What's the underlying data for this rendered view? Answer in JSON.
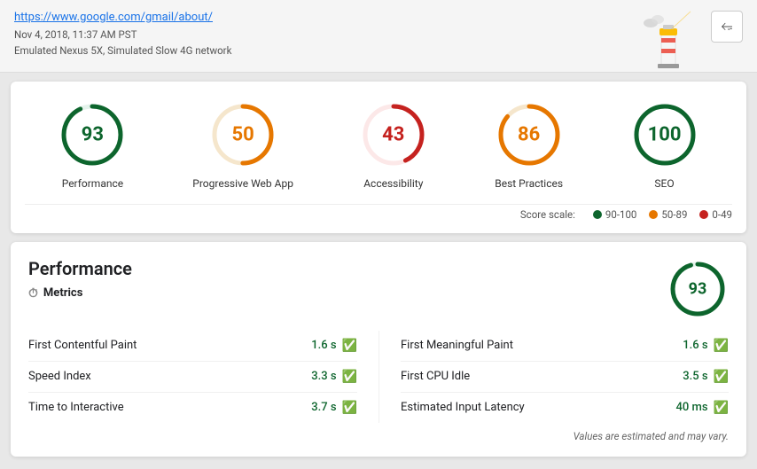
{
  "header": {
    "url": "https://www.google.com/gmail/about/",
    "timestamp": "Nov 4, 2018, 11:37 AM PST",
    "device": "Emulated Nexus 5X, Simulated Slow 4G network",
    "share_label": "⤴"
  },
  "scores": [
    {
      "id": "performance",
      "label": "Performance",
      "value": 93,
      "color": "#0d652d",
      "track": "#e5f3ec",
      "ring": "#0d652d"
    },
    {
      "id": "pwa",
      "label": "Progressive Web App",
      "value": 50,
      "color": "#e67700",
      "track": "#f5e6cc",
      "ring": "#e67700"
    },
    {
      "id": "accessibility",
      "label": "Accessibility",
      "value": 43,
      "color": "#c5221f",
      "track": "#fce8e8",
      "ring": "#c5221f"
    },
    {
      "id": "best-practices",
      "label": "Best Practices",
      "value": 86,
      "color": "#e67700",
      "track": "#f5e6cc",
      "ring": "#e67700"
    },
    {
      "id": "seo",
      "label": "SEO",
      "value": 100,
      "color": "#0d652d",
      "track": "#e5f3ec",
      "ring": "#0d652d"
    }
  ],
  "score_scale": {
    "label": "Score scale:",
    "items": [
      {
        "range": "90-100",
        "color": "#0d652d"
      },
      {
        "range": "50-89",
        "color": "#e67700"
      },
      {
        "range": "0-49",
        "color": "#c5221f"
      }
    ]
  },
  "performance_section": {
    "title": "Performance",
    "metrics_label": "Metrics",
    "score": 93,
    "metrics_left": [
      {
        "name": "First Contentful Paint",
        "value": "1.6 s"
      },
      {
        "name": "Speed Index",
        "value": "3.3 s"
      },
      {
        "name": "Time to Interactive",
        "value": "3.7 s"
      }
    ],
    "metrics_right": [
      {
        "name": "First Meaningful Paint",
        "value": "1.6 s"
      },
      {
        "name": "First CPU Idle",
        "value": "3.5 s"
      },
      {
        "name": "Estimated Input Latency",
        "value": "40 ms"
      }
    ],
    "values_note": "Values are estimated and may vary."
  }
}
